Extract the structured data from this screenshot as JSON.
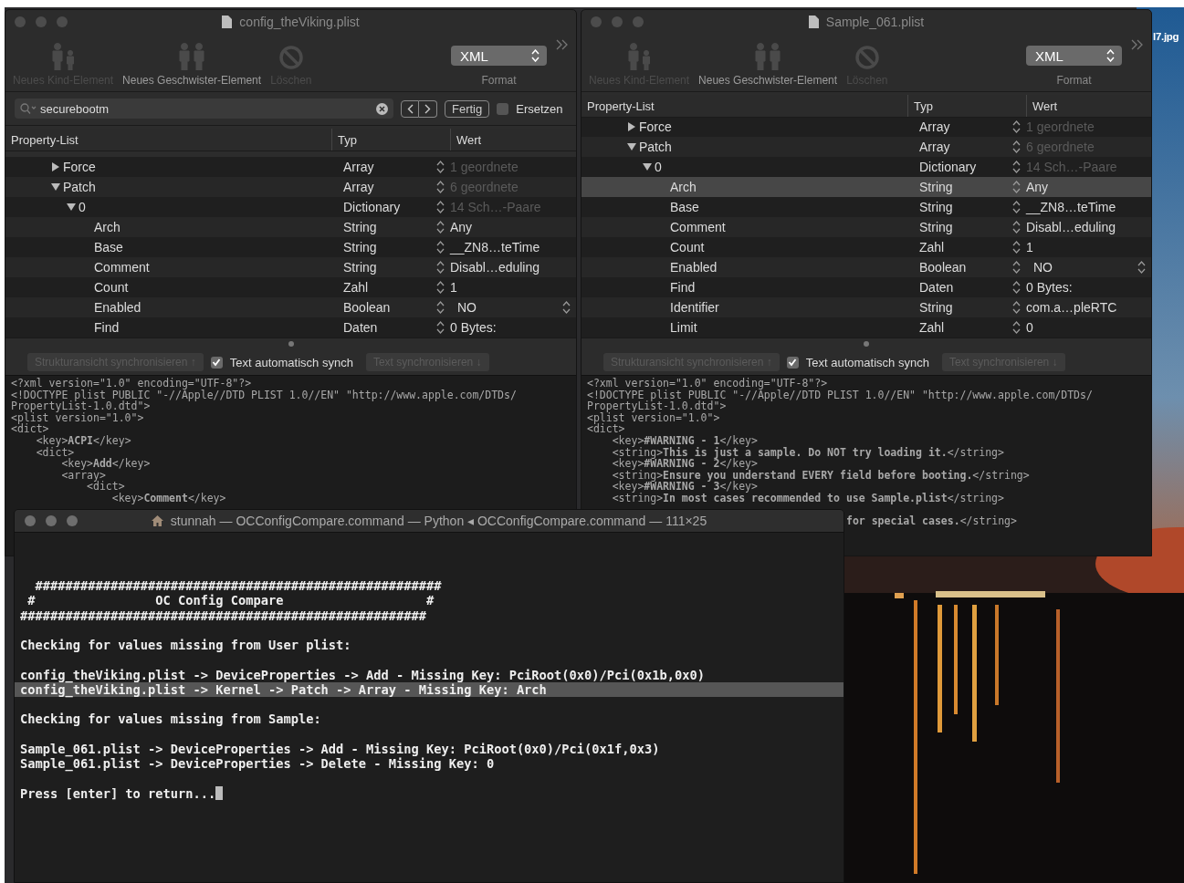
{
  "desktop": {
    "file_label": "l7.jpg"
  },
  "windows": [
    {
      "title": "config_theViking.plist",
      "toolbar": [
        {
          "kind": "child",
          "label": "Neues Kind-Element",
          "disabled": true
        },
        {
          "kind": "sibling",
          "label": "Neues Geschwister-Element",
          "disabled": false
        },
        {
          "kind": "delete",
          "label": "Löschen",
          "disabled": true
        }
      ],
      "format": {
        "value": "XML",
        "label": "Format"
      },
      "search": {
        "value": "securebootm",
        "done": "Fertig",
        "replace_label": "Ersetzen",
        "replace_checked": false
      },
      "columns": [
        "Property-List",
        "Typ",
        "Wert"
      ],
      "rows": [
        {
          "key": "Force",
          "type": "Array",
          "value": "1 geordnete",
          "disabled": true,
          "selected": false,
          "kind": "text",
          "expanded": false
        },
        {
          "key": "Patch",
          "type": "Array",
          "value": "6 geordnete",
          "disabled": true,
          "selected": false,
          "kind": "text",
          "expanded": true,
          "children": [
            {
              "key": "0",
              "type": "Dictionary",
              "value": "14 Sch…-Paare",
              "disabled": true,
              "selected": false,
              "kind": "text",
              "expanded": true,
              "children": [
                {
                  "key": "Arch",
                  "type": "String",
                  "value": "Any",
                  "disabled": false,
                  "selected": false,
                  "kind": "text"
                },
                {
                  "key": "Base",
                  "type": "String",
                  "value": "__ZN8…teTime",
                  "disabled": false,
                  "selected": false,
                  "kind": "text"
                },
                {
                  "key": "Comment",
                  "type": "String",
                  "value": "Disabl…eduling",
                  "disabled": false,
                  "selected": false,
                  "kind": "text"
                },
                {
                  "key": "Count",
                  "type": "Zahl",
                  "value": "1",
                  "disabled": false,
                  "selected": false,
                  "kind": "text"
                },
                {
                  "key": "Enabled",
                  "type": "Boolean",
                  "value": "NO",
                  "disabled": false,
                  "selected": false,
                  "kind": "popup"
                },
                {
                  "key": "Find",
                  "type": "Daten",
                  "value": "0 Bytes:",
                  "disabled": false,
                  "selected": false,
                  "kind": "text"
                }
              ]
            }
          ]
        }
      ],
      "sync": {
        "left": {
          "label": "Strukturansicht synchronisieren ↑",
          "disabled": true
        },
        "auto": {
          "label": "Text automatisch synch",
          "checked": true
        },
        "right": {
          "label": "Text synchronisieren ↓",
          "disabled": true
        }
      },
      "xml": [
        "<?xml version=\"1.0\" encoding=\"UTF-8\"?>",
        "<!DOCTYPE plist PUBLIC \"-//Apple//DTD PLIST 1.0//EN\" \"http://www.apple.com/DTDs/",
        "PropertyList-1.0.dtd\">",
        "<plist version=\"1.0\">",
        "<dict>",
        "    <key>**ACPI**</key>",
        "    <dict>",
        "        <key>**Add**</key>",
        "        <array>",
        "            <dict>",
        "                <key>**Comment**</key>"
      ]
    },
    {
      "title": "Sample_061.plist",
      "toolbar": [
        {
          "kind": "child",
          "label": "Neues Kind-Element",
          "disabled": true
        },
        {
          "kind": "sibling",
          "label": "Neues Geschwister-Element",
          "disabled": false
        },
        {
          "kind": "delete",
          "label": "Löschen",
          "disabled": true
        }
      ],
      "format": {
        "value": "XML",
        "label": "Format"
      },
      "columns": [
        "Property-List",
        "Typ",
        "Wert"
      ],
      "rows": [
        {
          "key": "Force",
          "type": "Array",
          "value": "1 geordnete",
          "disabled": true,
          "selected": false,
          "kind": "text",
          "expanded": false
        },
        {
          "key": "Patch",
          "type": "Array",
          "value": "6 geordnete",
          "disabled": true,
          "selected": false,
          "kind": "text",
          "expanded": true,
          "children": [
            {
              "key": "0",
              "type": "Dictionary",
              "value": "14 Sch…-Paare",
              "disabled": true,
              "selected": false,
              "kind": "text",
              "expanded": true,
              "children": [
                {
                  "key": "Arch",
                  "type": "String",
                  "value": "Any",
                  "disabled": false,
                  "selected": true,
                  "kind": "text"
                },
                {
                  "key": "Base",
                  "type": "String",
                  "value": "__ZN8…teTime",
                  "disabled": false,
                  "selected": false,
                  "kind": "text"
                },
                {
                  "key": "Comment",
                  "type": "String",
                  "value": "Disabl…eduling",
                  "disabled": false,
                  "selected": false,
                  "kind": "text"
                },
                {
                  "key": "Count",
                  "type": "Zahl",
                  "value": "1",
                  "disabled": false,
                  "selected": false,
                  "kind": "text"
                },
                {
                  "key": "Enabled",
                  "type": "Boolean",
                  "value": "NO",
                  "disabled": false,
                  "selected": false,
                  "kind": "popup"
                },
                {
                  "key": "Find",
                  "type": "Daten",
                  "value": "0 Bytes:",
                  "disabled": false,
                  "selected": false,
                  "kind": "text"
                },
                {
                  "key": "Identifier",
                  "type": "String",
                  "value": "com.a…pleRTC",
                  "disabled": false,
                  "selected": false,
                  "kind": "text"
                },
                {
                  "key": "Limit",
                  "type": "Zahl",
                  "value": "0",
                  "disabled": false,
                  "selected": false,
                  "kind": "text"
                }
              ]
            }
          ]
        }
      ],
      "sync": {
        "left": {
          "label": "Strukturansicht synchronisieren ↑",
          "disabled": true
        },
        "auto": {
          "label": "Text automatisch synch",
          "checked": true
        },
        "right": {
          "label": "Text synchronisieren ↓",
          "disabled": true
        }
      },
      "xml": [
        "<?xml version=\"1.0\" encoding=\"UTF-8\"?>",
        "<!DOCTYPE plist PUBLIC \"-//Apple//DTD PLIST 1.0//EN\" \"http://www.apple.com/DTDs/",
        "PropertyList-1.0.dtd\">",
        "<plist version=\"1.0\">",
        "<dict>",
        "    <key>**#WARNING - 1**</key>",
        "    <string>**This is just a sample. Do NOT try loading it.**</string>",
        "    <key>**#WARNING - 2**</key>",
        "    <string>**Ensure you understand EVERY field before booting.**</string>",
        "    <key>**#WARNING - 3**</key>",
        "    <string>**In most cases recommended to use Sample.plist**</string>"
      ],
      "xml_tail": "**for special cases.**</string>"
    }
  ],
  "terminal": {
    "title": "stunnah — OCConfigCompare.command — Python ◂ OCConfigCompare.command — 111×25",
    "blocks": [
      [
        {
          "text": "  ######################################################",
          "selected": false
        },
        {
          "text": " #                OC Config Compare                   #",
          "selected": false
        },
        {
          "text": "######################################################",
          "selected": false
        }
      ],
      [
        {
          "text": "Checking for values missing from User plist:",
          "selected": false
        }
      ],
      [
        {
          "text": "config_theViking.plist -> DeviceProperties -> Add - Missing Key: PciRoot(0x0)/Pci(0x1b,0x0)",
          "selected": false
        },
        {
          "text": "config_theViking.plist -> Kernel -> Patch -> Array - Missing Key: Arch",
          "selected": true
        }
      ],
      [
        {
          "text": "Checking for values missing from Sample:",
          "selected": false
        }
      ],
      [
        {
          "text": "Sample_061.plist -> DeviceProperties -> Add - Missing Key: PciRoot(0x0)/Pci(0x1f,0x3)",
          "selected": false
        },
        {
          "text": "Sample_061.plist -> DeviceProperties -> Delete - Missing Key: 0",
          "selected": false
        }
      ]
    ],
    "prompt": {
      "text": "Press [enter] to return...",
      "cursor": true
    }
  }
}
